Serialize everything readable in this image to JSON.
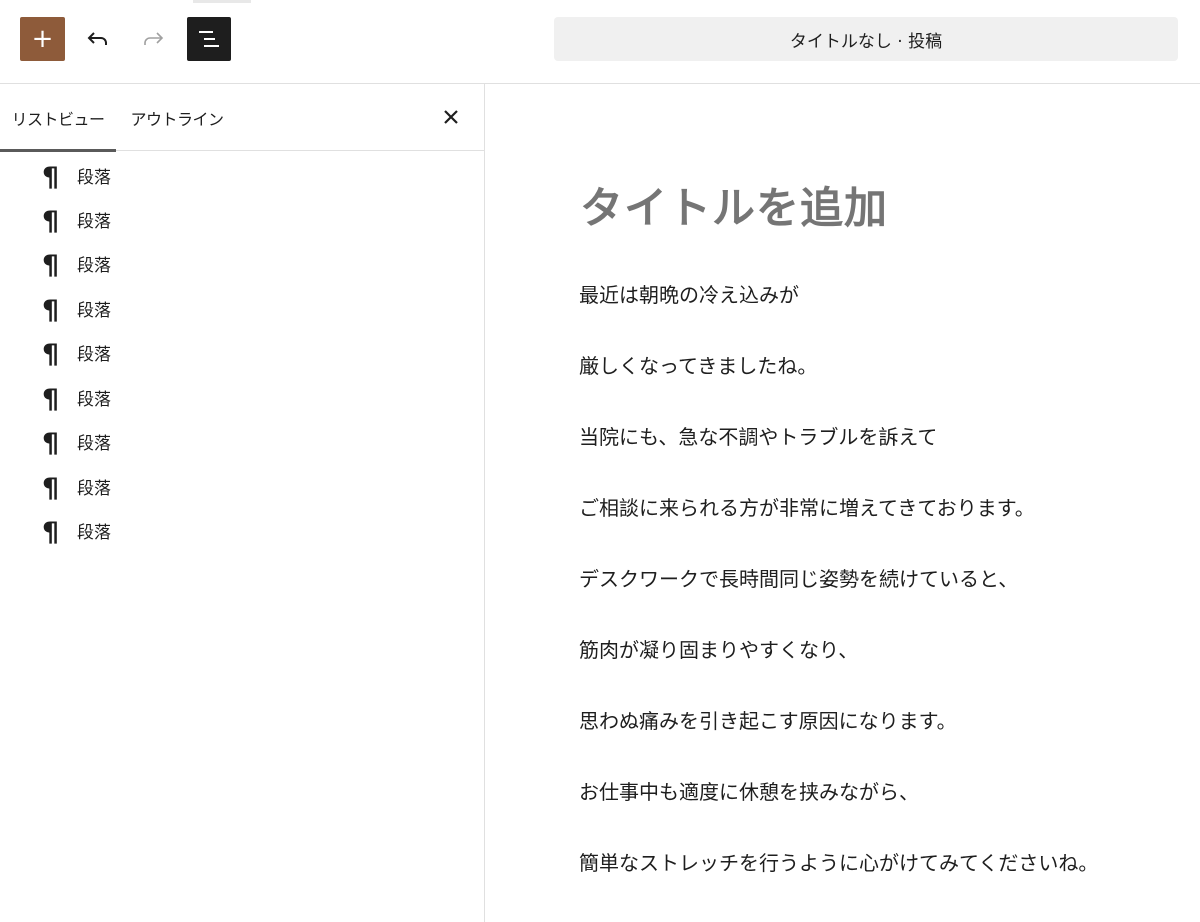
{
  "toolbar": {
    "add_label": "+",
    "document_title": "タイトルなし · 投稿"
  },
  "sidebar": {
    "tabs": [
      {
        "label": "リストビュー",
        "active": true
      },
      {
        "label": "アウトライン",
        "active": false
      }
    ],
    "close_label": "×",
    "items": [
      {
        "label": "段落"
      },
      {
        "label": "段落"
      },
      {
        "label": "段落"
      },
      {
        "label": "段落"
      },
      {
        "label": "段落"
      },
      {
        "label": "段落"
      },
      {
        "label": "段落"
      },
      {
        "label": "段落"
      },
      {
        "label": "段落"
      }
    ]
  },
  "editor": {
    "title_placeholder": "タイトルを追加",
    "paragraphs": [
      "最近は朝晩の冷え込みが",
      "厳しくなってきましたね。",
      "当院にも、急な不調やトラブルを訴えて",
      "ご相談に来られる方が非常に増えてきております。",
      "デスクワークで長時間同じ姿勢を続けていると、",
      "筋肉が凝り固まりやすくなり、",
      "思わぬ痛みを引き起こす原因になります。",
      "お仕事中も適度に休憩を挟みながら、",
      "簡単なストレッチを行うように心がけてみてくださいね。"
    ]
  },
  "colors": {
    "accent": "#8e5b3a",
    "dark": "#1e1e1e",
    "title_placeholder": "#757575"
  }
}
